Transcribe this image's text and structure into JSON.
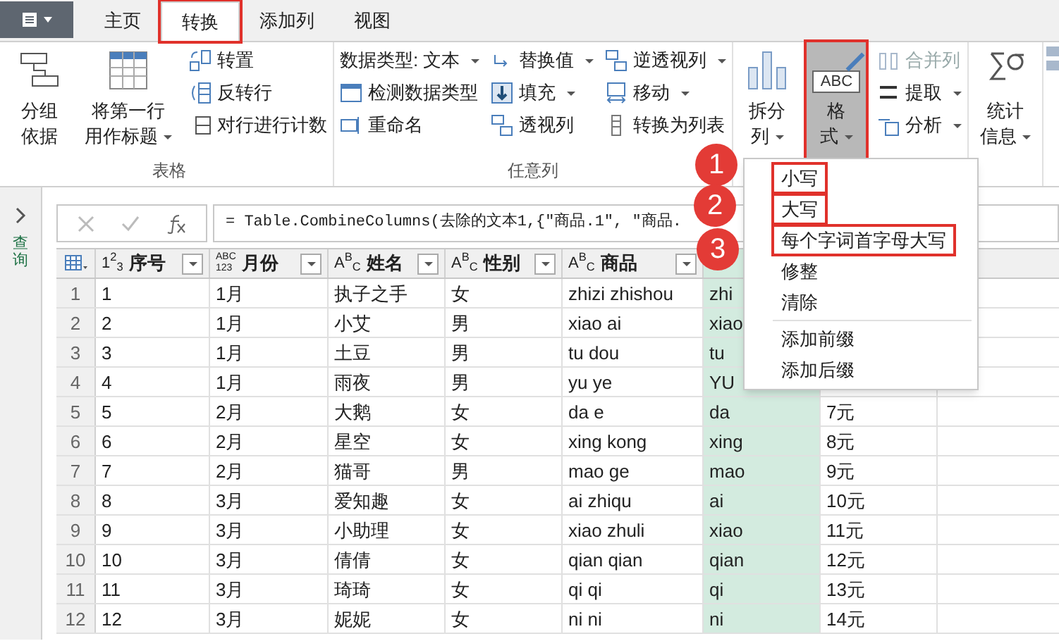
{
  "tabs": [
    {
      "label": "主页",
      "selected": false,
      "highlighted": false
    },
    {
      "label": "转换",
      "selected": true,
      "highlighted": true
    },
    {
      "label": "添加列",
      "selected": false,
      "highlighted": false
    },
    {
      "label": "视图",
      "selected": false,
      "highlighted": false
    }
  ],
  "ribbon": {
    "groups": [
      {
        "label": "表格",
        "columns": [
          {
            "kind": "large",
            "lines": [
              "分组",
              "依据"
            ],
            "dropdown": false,
            "pressed": false,
            "highlighted": false
          },
          {
            "kind": "large",
            "lines": [
              "将第一行",
              "用作标题"
            ],
            "dropdown": true,
            "pressed": false,
            "highlighted": false
          },
          {
            "kind": "stack",
            "items": [
              {
                "label": "转置",
                "dropdown": false,
                "disabled": false
              },
              {
                "label": "反转行",
                "dropdown": false,
                "disabled": false
              },
              {
                "label": "对行进行计数",
                "dropdown": false,
                "disabled": false
              }
            ]
          }
        ]
      },
      {
        "label": "任意列",
        "columns": [
          {
            "kind": "stack",
            "items": [
              {
                "label": "数据类型: 文本",
                "dropdown": true,
                "disabled": false
              },
              {
                "label": "检测数据类型",
                "dropdown": false,
                "disabled": false
              },
              {
                "label": "重命名",
                "dropdown": false,
                "disabled": false
              }
            ]
          },
          {
            "kind": "stack",
            "items": [
              {
                "label": "替换值",
                "dropdown": true,
                "disabled": false
              },
              {
                "label": "填充",
                "dropdown": true,
                "disabled": false
              },
              {
                "label": "透视列",
                "dropdown": false,
                "disabled": false
              }
            ]
          },
          {
            "kind": "stack",
            "items": [
              {
                "label": "逆透视列",
                "dropdown": true,
                "disabled": false
              },
              {
                "label": "移动",
                "dropdown": true,
                "disabled": false
              },
              {
                "label": "转换为列表",
                "dropdown": false,
                "disabled": false
              }
            ]
          }
        ]
      },
      {
        "columns": [
          {
            "kind": "large",
            "lines": [
              "拆分",
              "列"
            ],
            "dropdown": true,
            "pressed": false,
            "highlighted": false
          },
          {
            "kind": "large",
            "lines": [
              "格",
              "式"
            ],
            "dropdown": true,
            "pressed": true,
            "highlighted": true,
            "icon_text": "ABC"
          },
          {
            "kind": "stack",
            "items": [
              {
                "label": "合并列",
                "dropdown": false,
                "disabled": true
              },
              {
                "label": "提取",
                "dropdown": true,
                "disabled": false
              },
              {
                "label": "分析",
                "dropdown": true,
                "disabled": false
              }
            ]
          }
        ]
      },
      {
        "columns": [
          {
            "kind": "large",
            "lines": [
              "统计",
              "信息"
            ],
            "dropdown": true,
            "pressed": false,
            "highlighted": false
          }
        ]
      }
    ]
  },
  "formula_bar": {
    "formula": "= Table.CombineColumns(去除的文本1,{\"商品.1\", \"商品."
  },
  "table": {
    "columns": [
      {
        "kind": "inline",
        "type": "1$^{2}$$_{3}$",
        "label": "序号",
        "selected": false
      },
      {
        "kind": "stacked",
        "type": [
          "ABC",
          "123"
        ],
        "label": "月份",
        "selected": false
      },
      {
        "kind": "inline",
        "type": "A$^{B}$$_{C}$",
        "label": "姓名",
        "selected": false
      },
      {
        "kind": "inline",
        "type": "A$^{B}$$_{C}$",
        "label": "性别",
        "selected": false
      },
      {
        "kind": "inline",
        "type": "A$^{B}$$_{C}$",
        "label": "商品",
        "selected": false
      },
      {
        "kind": "blank",
        "selected": true
      }
    ],
    "rows": [
      {
        "index": "1",
        "cells": [
          "1",
          "1月",
          "执子之手",
          "女",
          "zhizi zhishou",
          "zhi",
          null
        ]
      },
      {
        "index": "2",
        "cells": [
          "2",
          "1月",
          "小艾",
          "男",
          "xiao ai",
          "xiao",
          null
        ]
      },
      {
        "index": "3",
        "cells": [
          "3",
          "1月",
          "土豆",
          "男",
          "tu dou",
          "tu",
          null
        ]
      },
      {
        "index": "4",
        "cells": [
          "4",
          "1月",
          "雨夜",
          "男",
          "yu ye",
          "YU",
          null
        ]
      },
      {
        "index": "5",
        "cells": [
          "5",
          "2月",
          "大鹅",
          "女",
          "da e",
          "da",
          "7元"
        ]
      },
      {
        "index": "6",
        "cells": [
          "6",
          "2月",
          "星空",
          "女",
          "xing kong",
          "xing",
          "8元"
        ]
      },
      {
        "index": "7",
        "cells": [
          "7",
          "2月",
          "猫哥",
          "男",
          "mao ge",
          "mao",
          "9元"
        ]
      },
      {
        "index": "8",
        "cells": [
          "8",
          "3月",
          "爱知趣",
          "女",
          "ai zhiqu",
          "ai",
          "10元"
        ]
      },
      {
        "index": "9",
        "cells": [
          "9",
          "3月",
          "小助理",
          "女",
          "xiao zhuli",
          "xiao",
          "11元"
        ]
      },
      {
        "index": "10",
        "cells": [
          "10",
          "3月",
          "倩倩",
          "女",
          "qian qian",
          "qian",
          "12元"
        ]
      },
      {
        "index": "11",
        "cells": [
          "11",
          "3月",
          "琦琦",
          "女",
          "qi qi",
          "qi",
          "13元"
        ]
      },
      {
        "index": "12",
        "cells": [
          "12",
          "3月",
          "妮妮",
          "女",
          "ni ni",
          "ni",
          "14元"
        ]
      }
    ]
  },
  "queries_pane": {
    "label": "查询"
  },
  "format_menu": {
    "items": [
      {
        "kind": "item",
        "label": "小写",
        "highlighted": true
      },
      {
        "kind": "item",
        "label": "大写",
        "highlighted": true
      },
      {
        "kind": "item",
        "label": "每个字词首字母大写",
        "highlighted": true
      },
      {
        "kind": "item",
        "label": "修整",
        "highlighted": false
      },
      {
        "kind": "item",
        "label": "清除",
        "highlighted": false
      },
      {
        "kind": "separator"
      },
      {
        "kind": "item",
        "label": "添加前缀",
        "highlighted": false
      },
      {
        "kind": "item",
        "label": "添加后缀",
        "highlighted": false
      }
    ]
  },
  "callouts": [
    {
      "label": "1"
    },
    {
      "label": "2"
    },
    {
      "label": "3"
    }
  ]
}
